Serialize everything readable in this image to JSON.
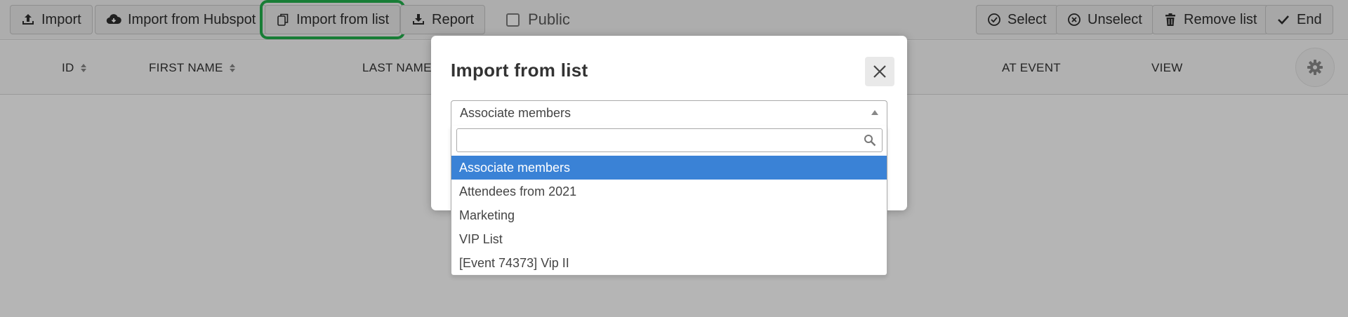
{
  "toolbar": {
    "import_label": "Import",
    "import_hubspot_label": "Import from Hubspot",
    "import_list_label": "Import from list",
    "report_label": "Report",
    "public_label": "Public",
    "select_label": "Select",
    "unselect_label": "Unselect",
    "remove_list_label": "Remove list",
    "end_label": "End"
  },
  "table": {
    "columns": [
      {
        "label": "ID",
        "sortable": true
      },
      {
        "label": "FIRST NAME",
        "sortable": true
      },
      {
        "label": "LAST NAME",
        "sortable": false
      },
      {
        "label": "AT EVENT",
        "sortable": false
      },
      {
        "label": "VIEW",
        "sortable": false
      }
    ]
  },
  "modal": {
    "title": "Import from list",
    "select": {
      "selected_value": "Associate members",
      "search_placeholder": "",
      "options": [
        "Associate members",
        "Attendees from 2021",
        "Marketing",
        "VIP List",
        "[Event 74373] Vip II"
      ],
      "highlighted_option": "Associate members"
    }
  },
  "colors": {
    "highlight_outline": "#22b14c",
    "option_highlight": "#3a82d6",
    "backdrop": "rgba(0,0,0,0.29)"
  }
}
